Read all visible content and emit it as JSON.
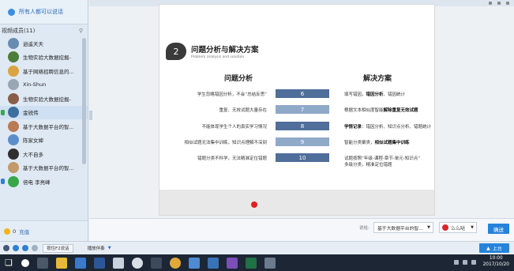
{
  "left_panel": {
    "notice": "所有人都可以说话",
    "members_title": "视频成员(11)",
    "members": [
      {
        "name": "逍遥天天",
        "color": "#6a8bb0"
      },
      {
        "name": "生物实验大数据挖掘-",
        "color": "#4c7d3a"
      },
      {
        "name": "基于网络招聘信息的...",
        "color": "#d9a441"
      },
      {
        "name": "Xin-Shun",
        "color": "#9aa6b3"
      },
      {
        "name": "生物实验大数据挖掘-",
        "color": "#8a5d4b"
      },
      {
        "name": "金锐伟",
        "color": "#3a6f9e"
      },
      {
        "name": "基于大数据平台的智...",
        "color": "#b87a55"
      },
      {
        "name": "陈家女婶",
        "color": "#5c8fc9"
      },
      {
        "name": "大不自多",
        "color": "#2f2f2f"
      },
      {
        "name": "基于大数据平台的智...",
        "color": "#c29a6b"
      },
      {
        "name": "倍电 李亮峰",
        "color": "#3aa64a"
      }
    ],
    "coins": "0",
    "recharge": "充值"
  },
  "slide": {
    "number": "2",
    "title": "问题分析与解决方案",
    "subtitle": "Problem analysis and solution",
    "left_heading": "问题分析",
    "right_heading": "解决方案",
    "rows": [
      {
        "problem": "学生忽略错因分析，不会“总结反思”",
        "value": "6",
        "bar_color": "#4f6f9a",
        "solution_bold": "错因分析",
        "solution_pre": "填写错因，",
        "solution_post": "、错因统计"
      },
      {
        "problem": "重复、无效试题大量存在",
        "value": "7",
        "bar_color": "#8fa9c9",
        "solution_bold": "解除重复无效试题",
        "solution_pre": "根据文本相似度智能",
        "solution_post": ""
      },
      {
        "problem": "不能体现学生个人的真实学习情况",
        "value": "8",
        "bar_color": "#4f6f9a",
        "solution_bold": "学情记录",
        "solution_pre": "",
        "solution_post": "：错因分析、知识点分析、错题统计"
      },
      {
        "problem": "相似试题无法集中训练，知识点理解不深刻",
        "value": "9",
        "bar_color": "#8fa9c9",
        "solution_bold": "相似试题集中训练",
        "solution_pre": "智能分类聚类，",
        "solution_post": ""
      },
      {
        "problem": "错题分类不科学，无法精准定位错题",
        "value": "10",
        "bar_color": "#4f6f9a",
        "solution_bold": "",
        "solution_pre": "试题按照“年级-课程-章节-单元-知识点”",
        "solution_post": "",
        "solution_line2": "多级分类，精准定位错题"
      }
    ]
  },
  "chat": {
    "target_label": "说给:",
    "target_value": "基于大数据平台的智...",
    "emoji_label": "么么哒",
    "send_label": "确送"
  },
  "bottom_bar": {
    "hold_label": "按住F2说话",
    "mode_label": "播放伴奏",
    "up_label": "上台"
  },
  "taskbar": {
    "time": "10:00",
    "date": "2017/10/20"
  }
}
